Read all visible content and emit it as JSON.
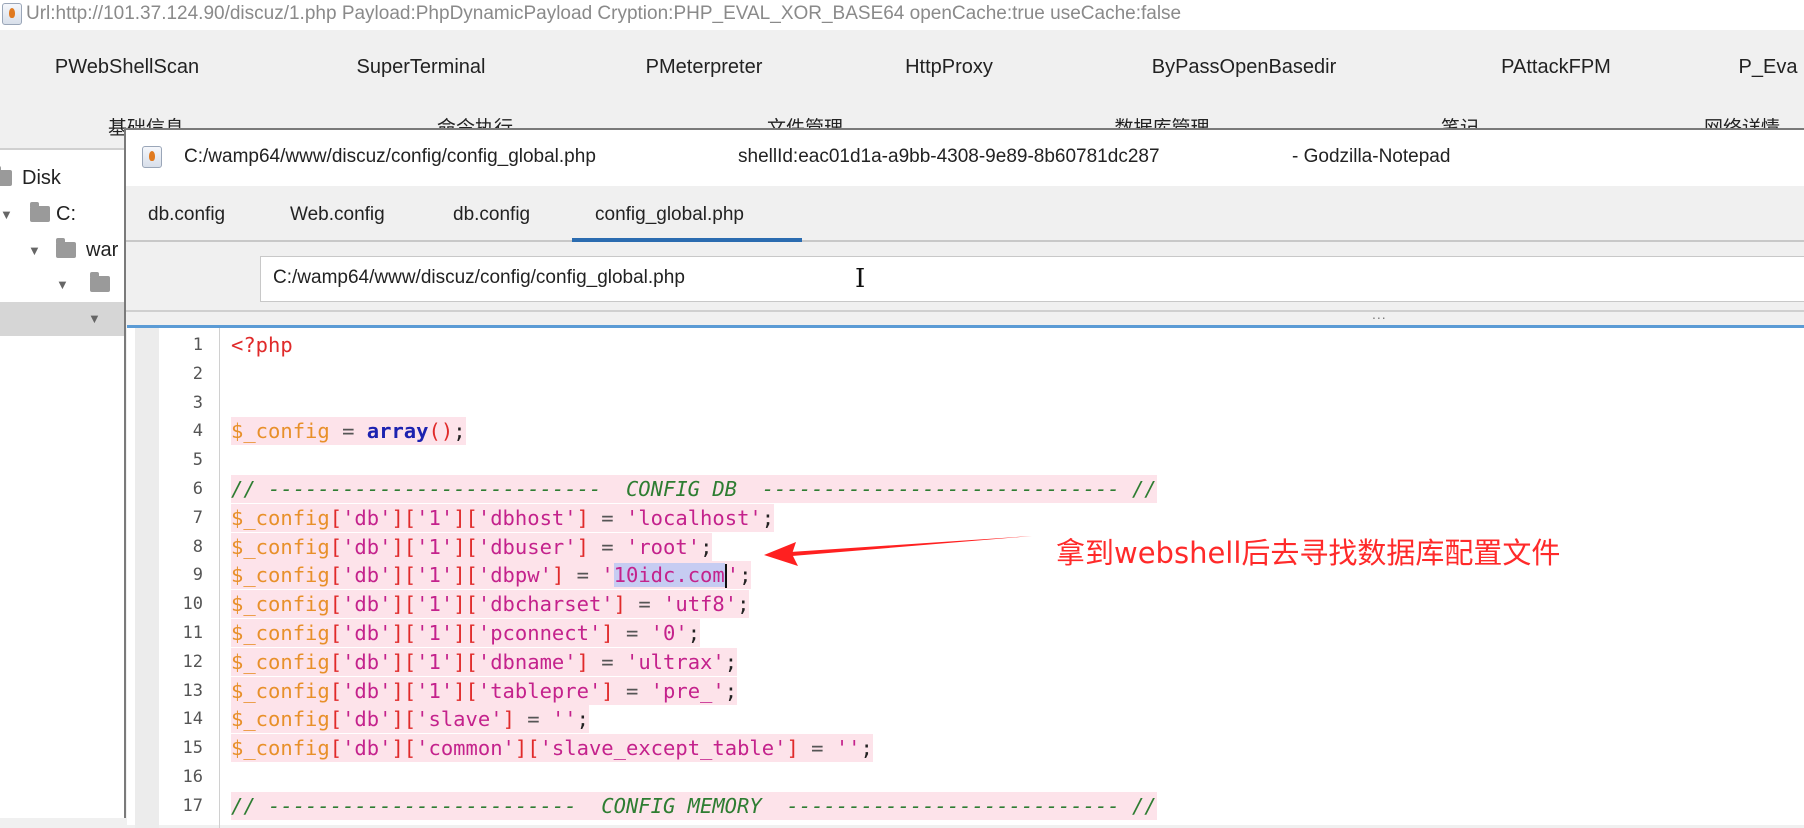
{
  "window_title": "Url:http://101.37.124.90/discuz/1.php Payload:PhpDynamicPayload Cryption:PHP_EVAL_XOR_BASE64 openCache:true useCache:false",
  "plugins": [
    "PWebShellScan",
    "SuperTerminal",
    "PMeterpreter",
    "HttpProxy",
    "ByPassOpenBasedir",
    "PAttackFPM",
    "P_Eva"
  ],
  "main_tabs": [
    "基础信息",
    "命令执行",
    "文件管理",
    "数据库管理",
    "笔记",
    "网络详情"
  ],
  "tree": {
    "items": [
      "Disk",
      "C:",
      "war",
      "",
      ""
    ]
  },
  "notepad": {
    "file_path": "C:/wamp64/www/discuz/config/config_global.php",
    "shell_id": "shellId:eac01d1a-a9bb-4308-9e89-8b60781dc287",
    "app_name": "- Godzilla-Notepad",
    "tabs": [
      "db.config",
      "Web.config",
      "db.config",
      "config_global.php"
    ],
    "active_tab": 3,
    "path_value": "C:/wamp64/www/discuz/config/config_global.php",
    "splitter": "...",
    "code_lines": [
      {
        "n": "1",
        "hl": false,
        "tokens": [
          [
            "tag",
            "<?php"
          ]
        ]
      },
      {
        "n": "2",
        "hl": false,
        "tokens": []
      },
      {
        "n": "3",
        "hl": false,
        "tokens": []
      },
      {
        "n": "4",
        "hl": true,
        "tokens": [
          [
            "var",
            "$_config"
          ],
          [
            "op",
            " = "
          ],
          [
            "kw",
            "array"
          ],
          [
            "br",
            "()"
          ],
          [
            "punc",
            ";"
          ]
        ]
      },
      {
        "n": "5",
        "hl": false,
        "tokens": []
      },
      {
        "n": "6",
        "hl": true,
        "tokens": [
          [
            "cmt",
            "// ---------------------------  CONFIG DB  ----------------------------- //"
          ]
        ]
      },
      {
        "n": "7",
        "hl": true,
        "tokens": [
          [
            "var",
            "$_config"
          ],
          [
            "br",
            "["
          ],
          [
            "str",
            "'db'"
          ],
          [
            "br",
            "]["
          ],
          [
            "str",
            "'1'"
          ],
          [
            "br",
            "]["
          ],
          [
            "str",
            "'dbhost'"
          ],
          [
            "br",
            "]"
          ],
          [
            "op",
            " = "
          ],
          [
            "str",
            "'localhost'"
          ],
          [
            "punc",
            ";"
          ]
        ]
      },
      {
        "n": "8",
        "hl": true,
        "tokens": [
          [
            "var",
            "$_config"
          ],
          [
            "br",
            "["
          ],
          [
            "str",
            "'db'"
          ],
          [
            "br",
            "]["
          ],
          [
            "str",
            "'1'"
          ],
          [
            "br",
            "]["
          ],
          [
            "str",
            "'dbuser'"
          ],
          [
            "br",
            "]"
          ],
          [
            "op",
            " = "
          ],
          [
            "str",
            "'root'"
          ],
          [
            "punc",
            ";"
          ]
        ]
      },
      {
        "n": "9",
        "hl": true,
        "tokens": [
          [
            "var",
            "$_config"
          ],
          [
            "br",
            "["
          ],
          [
            "str",
            "'db'"
          ],
          [
            "br",
            "]["
          ],
          [
            "str",
            "'1'"
          ],
          [
            "br",
            "]["
          ],
          [
            "str",
            "'dbpw'"
          ],
          [
            "br",
            "]"
          ],
          [
            "op",
            " = "
          ],
          [
            "str",
            "'"
          ],
          [
            "sel",
            "10idc.com"
          ],
          [
            "caret",
            ""
          ],
          [
            "str",
            "'"
          ],
          [
            "punc",
            ";"
          ]
        ]
      },
      {
        "n": "10",
        "hl": true,
        "tokens": [
          [
            "var",
            "$_config"
          ],
          [
            "br",
            "["
          ],
          [
            "str",
            "'db'"
          ],
          [
            "br",
            "]["
          ],
          [
            "str",
            "'1'"
          ],
          [
            "br",
            "]["
          ],
          [
            "str",
            "'dbcharset'"
          ],
          [
            "br",
            "]"
          ],
          [
            "op",
            " = "
          ],
          [
            "str",
            "'utf8'"
          ],
          [
            "punc",
            ";"
          ]
        ]
      },
      {
        "n": "11",
        "hl": true,
        "tokens": [
          [
            "var",
            "$_config"
          ],
          [
            "br",
            "["
          ],
          [
            "str",
            "'db'"
          ],
          [
            "br",
            "]["
          ],
          [
            "str",
            "'1'"
          ],
          [
            "br",
            "]["
          ],
          [
            "str",
            "'pconnect'"
          ],
          [
            "br",
            "]"
          ],
          [
            "op",
            " = "
          ],
          [
            "str",
            "'0'"
          ],
          [
            "punc",
            ";"
          ]
        ]
      },
      {
        "n": "12",
        "hl": true,
        "tokens": [
          [
            "var",
            "$_config"
          ],
          [
            "br",
            "["
          ],
          [
            "str",
            "'db'"
          ],
          [
            "br",
            "]["
          ],
          [
            "str",
            "'1'"
          ],
          [
            "br",
            "]["
          ],
          [
            "str",
            "'dbname'"
          ],
          [
            "br",
            "]"
          ],
          [
            "op",
            " = "
          ],
          [
            "str",
            "'ultrax'"
          ],
          [
            "punc",
            ";"
          ]
        ]
      },
      {
        "n": "13",
        "hl": true,
        "tokens": [
          [
            "var",
            "$_config"
          ],
          [
            "br",
            "["
          ],
          [
            "str",
            "'db'"
          ],
          [
            "br",
            "]["
          ],
          [
            "str",
            "'1'"
          ],
          [
            "br",
            "]["
          ],
          [
            "str",
            "'tablepre'"
          ],
          [
            "br",
            "]"
          ],
          [
            "op",
            " = "
          ],
          [
            "str",
            "'pre_'"
          ],
          [
            "punc",
            ";"
          ]
        ]
      },
      {
        "n": "14",
        "hl": true,
        "tokens": [
          [
            "var",
            "$_config"
          ],
          [
            "br",
            "["
          ],
          [
            "str",
            "'db'"
          ],
          [
            "br",
            "]["
          ],
          [
            "str",
            "'slave'"
          ],
          [
            "br",
            "]"
          ],
          [
            "op",
            " = "
          ],
          [
            "str",
            "''"
          ],
          [
            "punc",
            ";"
          ]
        ]
      },
      {
        "n": "15",
        "hl": true,
        "tokens": [
          [
            "var",
            "$_config"
          ],
          [
            "br",
            "["
          ],
          [
            "str",
            "'db'"
          ],
          [
            "br",
            "]["
          ],
          [
            "str",
            "'common'"
          ],
          [
            "br",
            "]["
          ],
          [
            "str",
            "'slave_except_table'"
          ],
          [
            "br",
            "]"
          ],
          [
            "op",
            " = "
          ],
          [
            "str",
            "''"
          ],
          [
            "punc",
            ";"
          ]
        ]
      },
      {
        "n": "16",
        "hl": false,
        "tokens": []
      },
      {
        "n": "17",
        "hl": true,
        "tokens": [
          [
            "cmt",
            "// -------------------------  CONFIG MEMORY  --------------------------- //"
          ]
        ]
      }
    ]
  },
  "annotation": "拿到webshell后去寻找数据库配置文件",
  "colors": {
    "annotation": "#ff2a2a",
    "highlight": "#fde3ea",
    "active_tab": "#2b6cb0"
  }
}
